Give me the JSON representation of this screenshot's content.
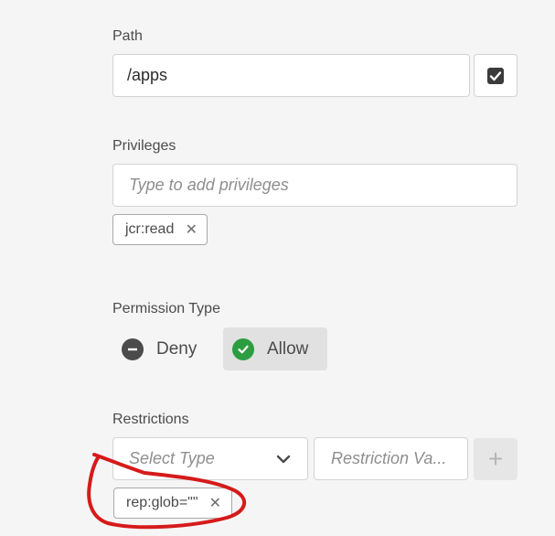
{
  "path": {
    "label": "Path",
    "value": "/apps",
    "checkbox_checked": true
  },
  "privileges": {
    "label": "Privileges",
    "placeholder": "Type to add privileges",
    "tags": [
      {
        "label": "jcr:read",
        "remove": "✕"
      }
    ]
  },
  "permission": {
    "label": "Permission Type",
    "options": [
      {
        "label": "Deny",
        "selected": false,
        "icon": "minus-circle-icon",
        "color": "#4b4b4b"
      },
      {
        "label": "Allow",
        "selected": true,
        "icon": "check-circle-icon",
        "color": "#2d9d41"
      }
    ]
  },
  "restrictions": {
    "label": "Restrictions",
    "type_placeholder": "Select Type",
    "value_placeholder": "Restriction Va...",
    "add_label": "+",
    "tags": [
      {
        "label": "rep:glob=\"\"",
        "remove": "✕"
      }
    ]
  },
  "annotation": {
    "color": "#d61a1a",
    "shape": "hand-drawn circle"
  }
}
